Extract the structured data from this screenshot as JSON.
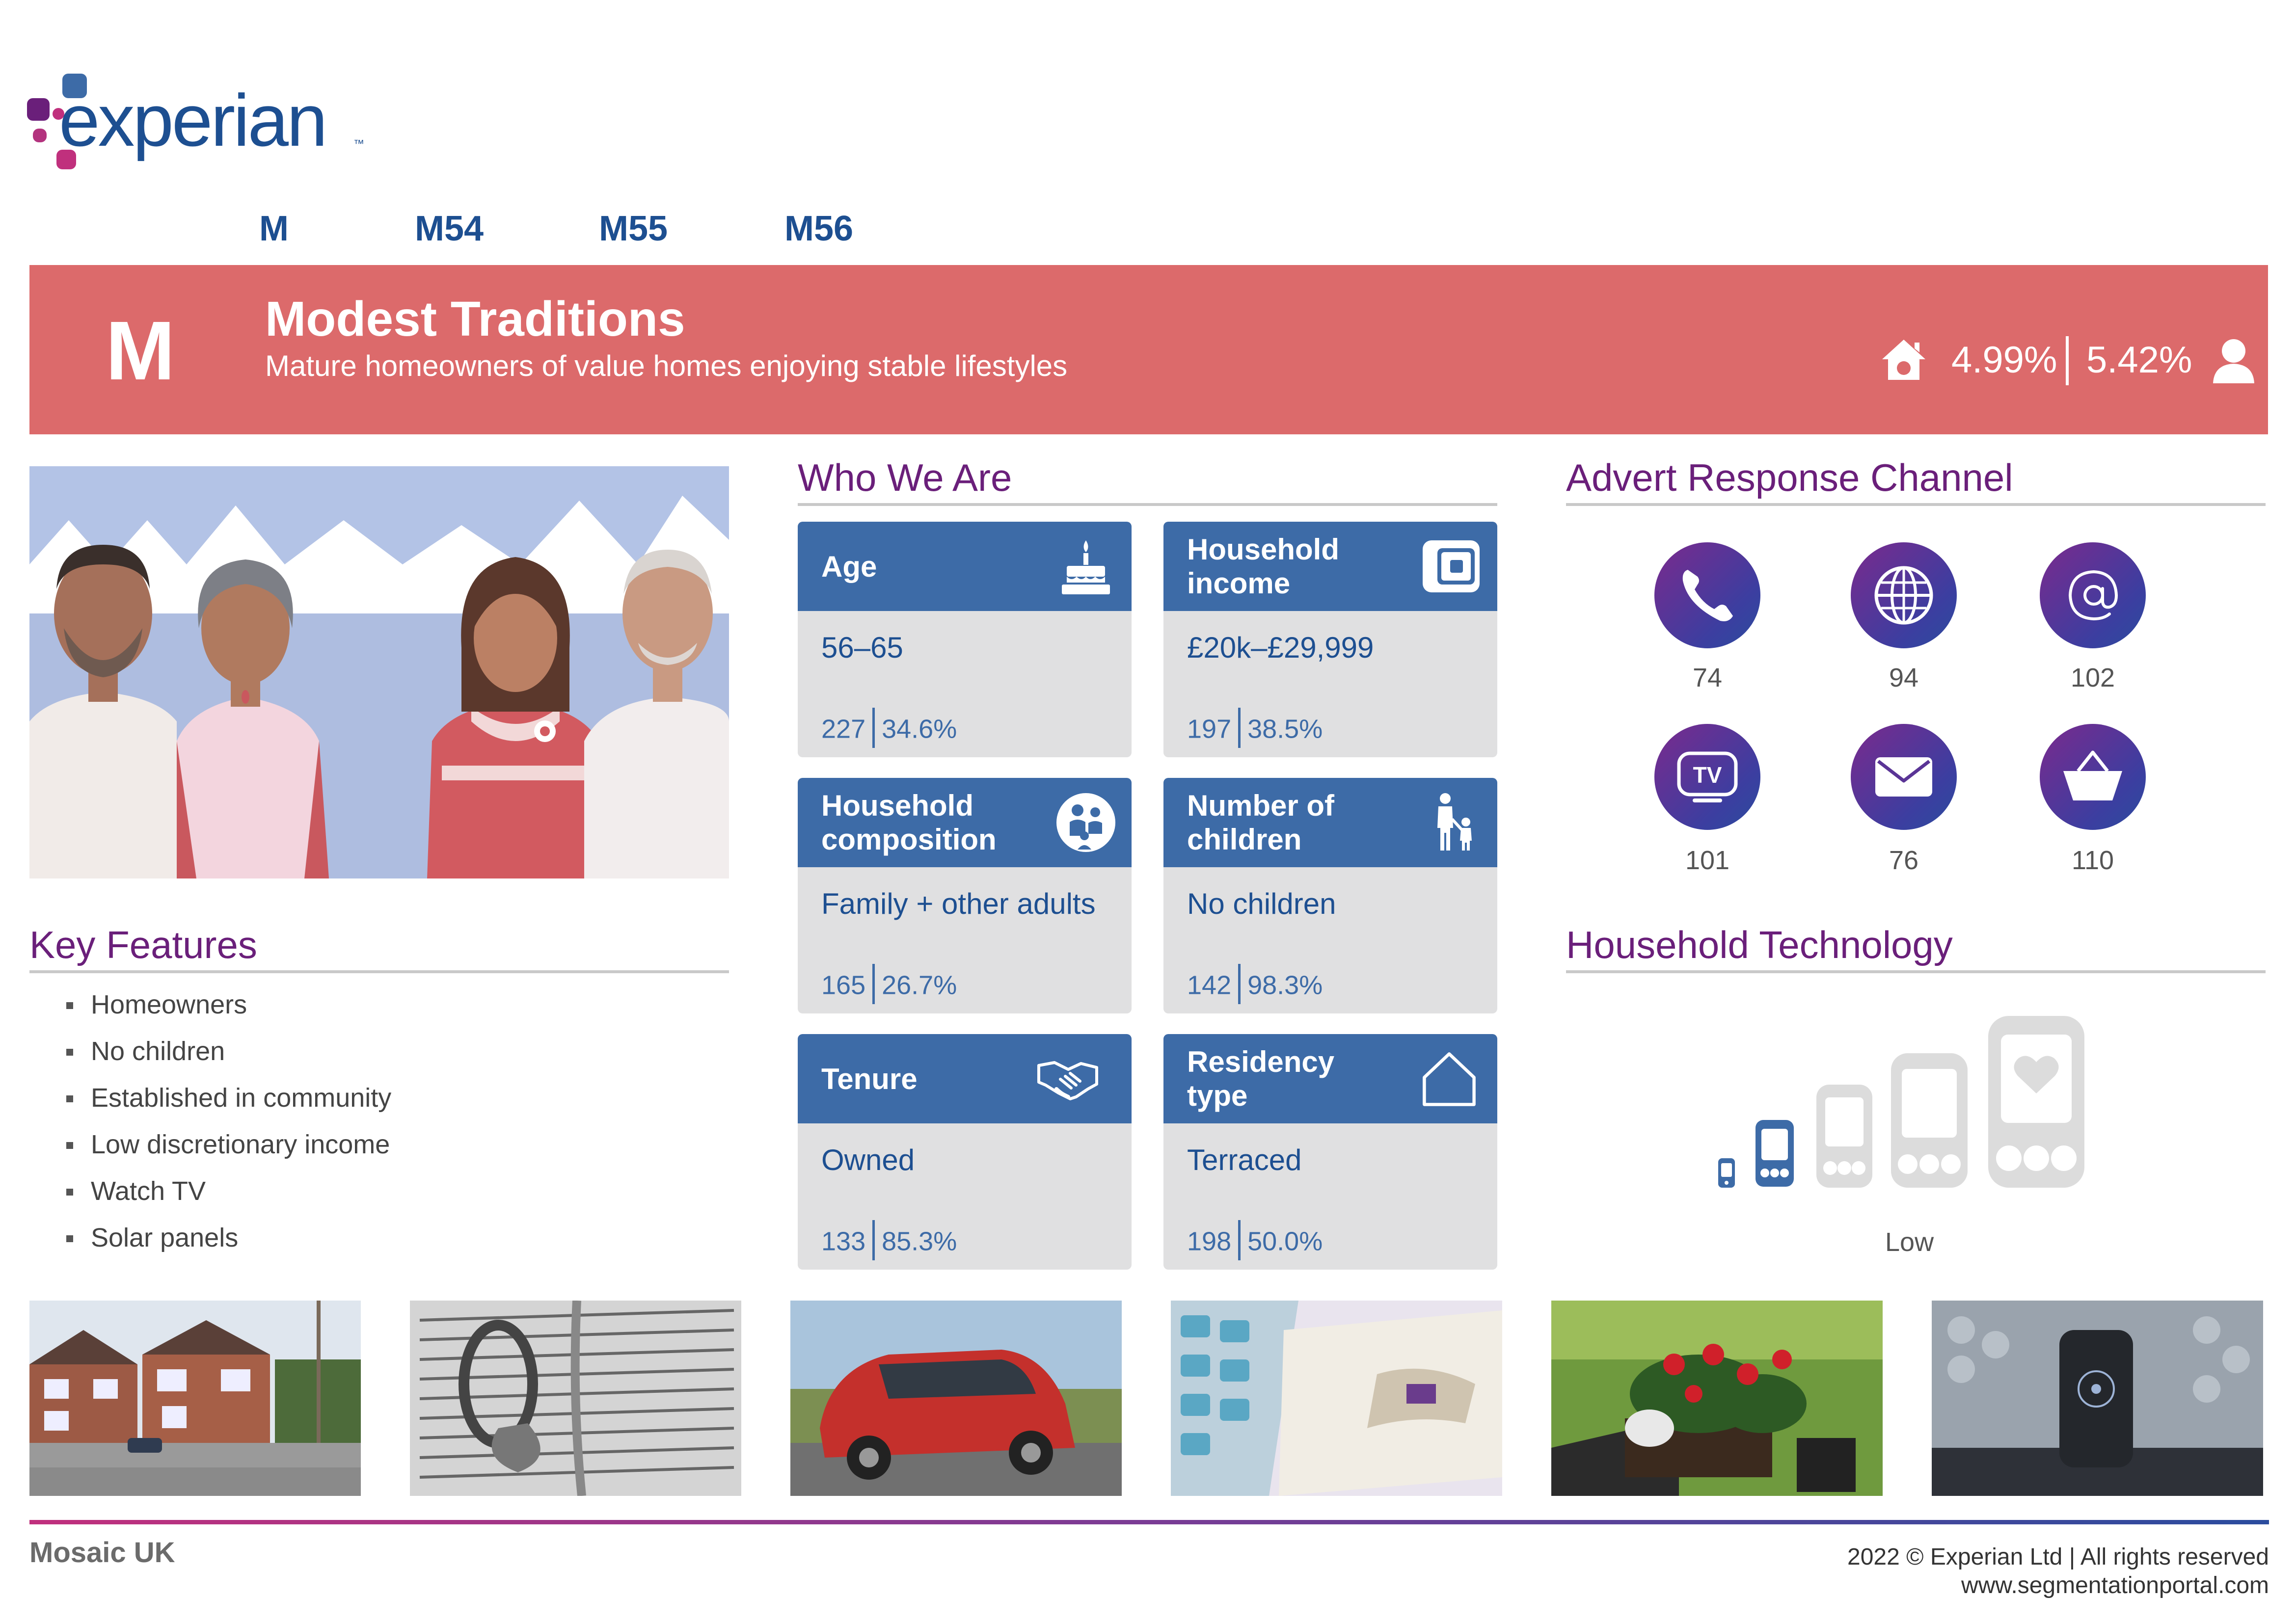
{
  "brand": {
    "logo_text": "experian",
    "trademark": "™"
  },
  "nav": {
    "items": [
      "M",
      "M54",
      "M55",
      "M56"
    ]
  },
  "banner": {
    "letter": "M",
    "title": "Modest Traditions",
    "subtitle": "Mature homeowners of value homes enjoying stable lifestyles",
    "household_pct": "4.99%",
    "person_pct": "5.42%",
    "color": "#dc6a6b"
  },
  "key_features": {
    "heading": "Key Features",
    "items": [
      "Homeowners",
      "No children",
      "Established in community",
      "Low discretionary income",
      "Watch TV",
      "Solar panels"
    ]
  },
  "who_we_are": {
    "heading": "Who We Are",
    "cards": [
      {
        "label": "Age",
        "icon": "birthday-cake-icon",
        "value": "56–65",
        "index": "227",
        "percent": "34.6%"
      },
      {
        "label": "Household income",
        "icon": "wallet-icon",
        "value": "£20k–£29,999",
        "index": "197",
        "percent": "38.5%"
      },
      {
        "label": "Household composition",
        "icon": "family-icon",
        "value": "Family + other adults",
        "index": "165",
        "percent": "26.7%"
      },
      {
        "label": "Number of children",
        "icon": "adult-child-icon",
        "value": "No children",
        "index": "142",
        "percent": "98.3%"
      },
      {
        "label": "Tenure",
        "icon": "handshake-icon",
        "value": "Owned",
        "index": "133",
        "percent": "85.3%"
      },
      {
        "label": "Residency type",
        "icon": "house-outline-icon",
        "value": "Terraced",
        "index": "198",
        "percent": "50.0%"
      }
    ]
  },
  "advert_channel": {
    "heading": "Advert Response Channel",
    "channels": [
      {
        "icon": "phone-icon",
        "value": "74"
      },
      {
        "icon": "globe-icon",
        "value": "94"
      },
      {
        "icon": "at-sign-icon",
        "value": "102"
      },
      {
        "icon": "tv-icon",
        "value": "101"
      },
      {
        "icon": "envelope-icon",
        "value": "76"
      },
      {
        "icon": "shopping-basket-icon",
        "value": "110"
      }
    ]
  },
  "household_technology": {
    "heading": "Household Technology",
    "level_label": "Low",
    "level": 2,
    "level_max": 5
  },
  "photos": [
    "street-photo",
    "bible-rings-photo",
    "red-car-photo",
    "calculator-money-photo",
    "gardening-photo",
    "smart-speaker-photo"
  ],
  "footer": {
    "brand": "Mosaic UK",
    "copyright": "2022 © Experian Ltd | All rights reserved",
    "website": "www.segmentationportal.com"
  },
  "colors": {
    "accent_blue": "#1d4f91",
    "card_header": "#3d6ba7",
    "heading_purple": "#6a1f7a"
  }
}
